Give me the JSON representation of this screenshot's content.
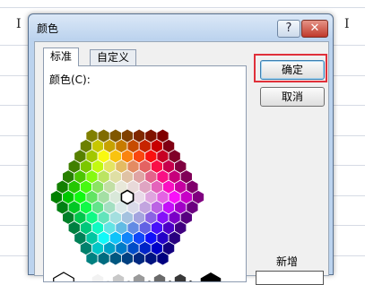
{
  "dialog": {
    "title": "颜色",
    "help_symbol": "?",
    "close_symbol": "✕",
    "tabs": [
      {
        "label": "标准",
        "active": true
      },
      {
        "label": "自定义",
        "active": false
      }
    ],
    "colors_label": "颜色(C):",
    "ok_label": "确定",
    "cancel_label": "取消",
    "new_label": "新增",
    "highlight_color": "#e0303a"
  },
  "background": {
    "cursor_glyph": "I"
  },
  "icons": {
    "help": "question-mark-icon",
    "close": "close-icon"
  }
}
